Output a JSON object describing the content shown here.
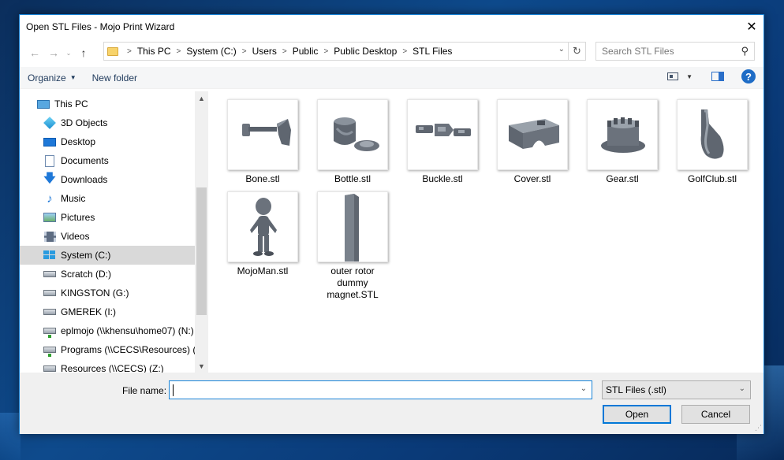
{
  "window": {
    "title": "Open STL Files - Mojo Print Wizard",
    "close_glyph": "✕"
  },
  "navigation": {
    "back_glyph": "←",
    "forward_glyph": "→",
    "recent_glyph": "⌄",
    "up_glyph": "↑",
    "breadcrumb": [
      "This PC",
      "System (C:)",
      "Users",
      "Public",
      "Public Desktop",
      "STL Files"
    ],
    "refresh_glyph": "↻",
    "dropdown_glyph": "⌄"
  },
  "search": {
    "placeholder": "Search STL Files",
    "icon": "⚲"
  },
  "toolbar": {
    "organize_label": "Organize",
    "new_folder_label": "New folder",
    "help_glyph": "?"
  },
  "sidebar": {
    "items": [
      {
        "label": "This PC",
        "icon": "pc-icon"
      },
      {
        "label": "3D Objects",
        "icon": "3d-objects-icon"
      },
      {
        "label": "Desktop",
        "icon": "desktop-icon"
      },
      {
        "label": "Documents",
        "icon": "documents-icon"
      },
      {
        "label": "Downloads",
        "icon": "downloads-icon",
        "glyph": "🡇"
      },
      {
        "label": "Music",
        "icon": "music-icon",
        "glyph": "♪"
      },
      {
        "label": "Pictures",
        "icon": "pictures-icon"
      },
      {
        "label": "Videos",
        "icon": "videos-icon"
      },
      {
        "label": "System (C:)",
        "icon": "system-drive-icon",
        "selected": true
      },
      {
        "label": "Scratch (D:)",
        "icon": "drive-icon"
      },
      {
        "label": "KINGSTON (G:)",
        "icon": "drive-icon"
      },
      {
        "label": "GMEREK (I:)",
        "icon": "drive-icon"
      },
      {
        "label": "eplmojo (\\\\khensu\\home07) (N:)",
        "icon": "network-drive-icon"
      },
      {
        "label": "Programs (\\\\CECS\\Resources) (P:)",
        "icon": "network-drive-icon"
      },
      {
        "label": "Resources (\\\\CECS) (Z:)",
        "icon": "network-drive-icon"
      }
    ],
    "scroll_up_glyph": "▲",
    "scroll_down_glyph": "▼"
  },
  "files": [
    {
      "name": "Bone.stl",
      "icon": "bone-thumbnail"
    },
    {
      "name": "Bottle.stl",
      "icon": "bottle-thumbnail"
    },
    {
      "name": "Buckle.stl",
      "icon": "buckle-thumbnail"
    },
    {
      "name": "Cover.stl",
      "icon": "cover-thumbnail"
    },
    {
      "name": "Gear.stl",
      "icon": "gear-thumbnail"
    },
    {
      "name": "GolfClub.stl",
      "icon": "golfclub-thumbnail"
    },
    {
      "name": "MojoMan.stl",
      "icon": "mojoman-thumbnail"
    },
    {
      "name": "outer rotor dummy magnet.STL",
      "icon": "magnet-thumbnail"
    }
  ],
  "footer": {
    "file_name_label": "File name:",
    "file_name_value": "",
    "file_type_value": "STL Files (.stl)",
    "open_label": "Open",
    "cancel_label": "Cancel",
    "dropdown_glyph": "⌄"
  },
  "colors": {
    "accent": "#1883d7",
    "model_gray": "#5f6670",
    "selected_bg": "#d9d9d9"
  }
}
